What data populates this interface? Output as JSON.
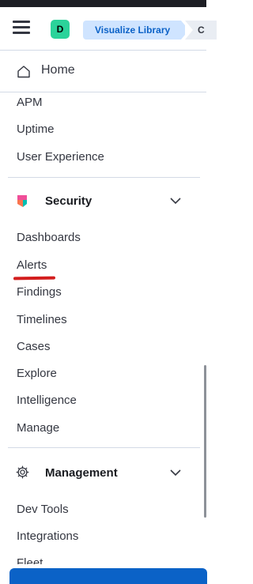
{
  "header": {
    "space_avatar": "D",
    "breadcrumbs": [
      "Visualize Library",
      "C"
    ],
    "menu_icon": "hamburger-icon"
  },
  "home": {
    "label": "Home",
    "icon": "home-icon"
  },
  "observability_items": [
    "APM",
    "Uptime",
    "User Experience"
  ],
  "security": {
    "title": "Security",
    "icon": "security-logo-icon",
    "items": [
      "Dashboards",
      "Alerts",
      "Findings",
      "Timelines",
      "Cases",
      "Explore",
      "Intelligence",
      "Manage"
    ]
  },
  "management": {
    "title": "Management",
    "icon": "gear-icon",
    "items": [
      "Dev Tools",
      "Integrations",
      "Fleet"
    ]
  },
  "colors": {
    "accent": "#0b62c7",
    "breadcrumb_bg": "#cfe4ff",
    "avatar_bg": "#2bd39a",
    "annotation": "#d31e1e"
  }
}
